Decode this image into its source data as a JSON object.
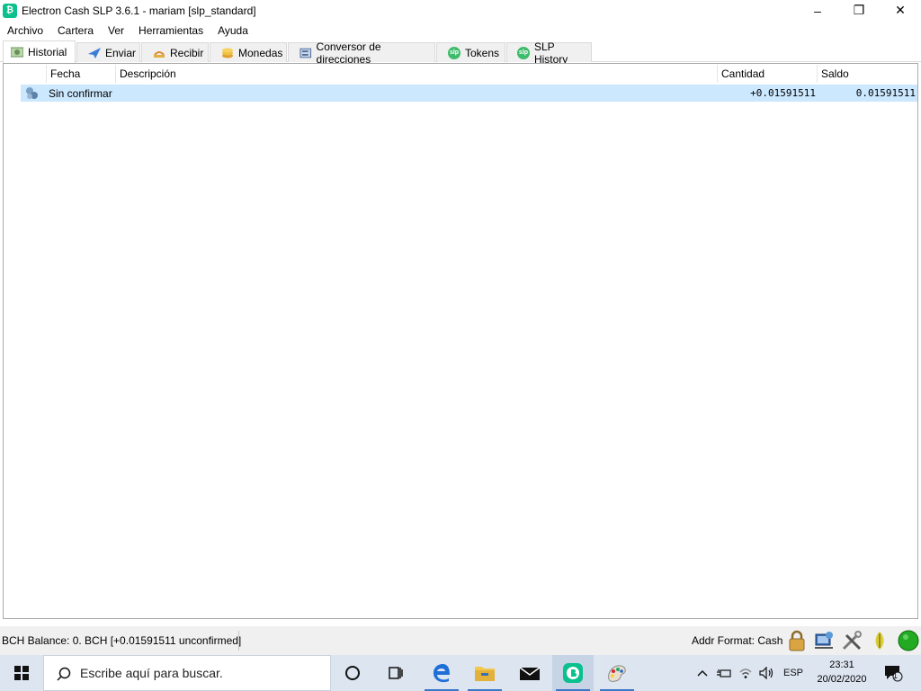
{
  "window": {
    "title": "Electron Cash SLP 3.6.1  -  mariam  [slp_standard]",
    "controls": {
      "minimize": "–",
      "restore": "❐",
      "close": "✕"
    }
  },
  "menu": [
    "Archivo",
    "Cartera",
    "Ver",
    "Herramientas",
    "Ayuda"
  ],
  "tabs": [
    {
      "label": "Historial",
      "icon": "history-icon",
      "active": true
    },
    {
      "label": "Enviar",
      "icon": "send-icon"
    },
    {
      "label": "Recibir",
      "icon": "receive-icon"
    },
    {
      "label": "Monedas",
      "icon": "coins-icon"
    },
    {
      "label": "Conversor de direcciones",
      "icon": "address-converter-icon"
    },
    {
      "label": "Tokens",
      "icon": "slp-icon"
    },
    {
      "label": "SLP History",
      "icon": "slp-icon"
    }
  ],
  "history": {
    "columns": {
      "date": "Fecha",
      "description": "Descripción",
      "amount": "Cantidad",
      "balance": "Saldo"
    },
    "rows": [
      {
        "status_icon": "unconfirmed-icon",
        "date": "Sin confirmar",
        "description": "",
        "amount": "+0.01591511",
        "balance": "0.01591511"
      }
    ]
  },
  "status": {
    "balance": "BCH Balance: 0. BCH  [+0.01591511 unconfirmed]",
    "addr_format": "Addr Format: Cash",
    "icons": [
      "lock-icon",
      "network-preferences-icon",
      "tools-icon",
      "seed-icon",
      "connection-status-icon"
    ]
  },
  "taskbar": {
    "search_placeholder": "Escribe aquí para buscar.",
    "language": "ESP",
    "time": "23:31",
    "date": "20/02/2020",
    "notification_count": "1"
  },
  "colors": {
    "selection": "#cce8ff",
    "bch_green": "#0ac18e",
    "slp_green": "#3dbb6a",
    "status_online": "#22aa22"
  }
}
